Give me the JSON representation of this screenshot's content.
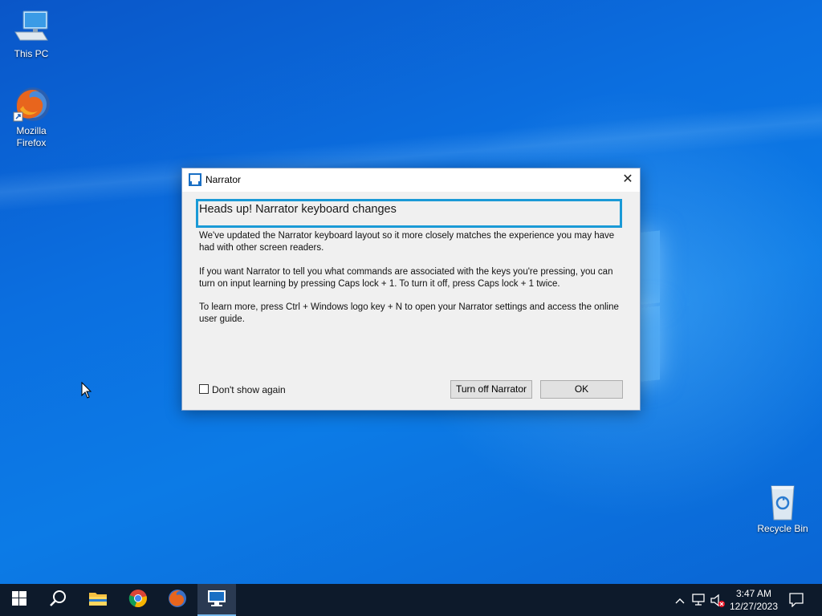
{
  "desktop": {
    "icons": [
      {
        "label": "This PC"
      },
      {
        "label": "Mozilla Firefox"
      },
      {
        "label": "Recycle Bin"
      }
    ]
  },
  "dialog": {
    "title": "Narrator",
    "close_glyph": "✕",
    "heading": "Heads up! Narrator keyboard changes",
    "paragraphs": [
      "We've updated the Narrator keyboard layout so it more closely matches the experience you may have had with other screen readers.",
      "If you want Narrator to tell you what commands are associated with the keys you're pressing, you can turn on input learning by pressing Caps lock + 1. To turn it off, press Caps lock + 1 twice.",
      "To learn more, press Ctrl + Windows logo key + N to open your Narrator settings and access the online user guide."
    ],
    "checkbox_label": "Don't show again",
    "checkbox_checked": false,
    "turn_off_label": "Turn off Narrator",
    "ok_label": "OK"
  },
  "taskbar": {
    "items": [
      "start-icon",
      "search-icon",
      "file-explorer-icon",
      "chrome-icon",
      "firefox-icon",
      "narrator-icon"
    ],
    "active_item": "narrator-icon",
    "tray": [
      "chevron-up-icon",
      "network-icon",
      "volume-muted-icon"
    ],
    "clock_time": "3:47 AM",
    "clock_date": "12/27/2023"
  },
  "colors": {
    "accent": "#1a9ad6",
    "taskbar": "#0d1a2b",
    "desktop": "#0b6fe0"
  }
}
